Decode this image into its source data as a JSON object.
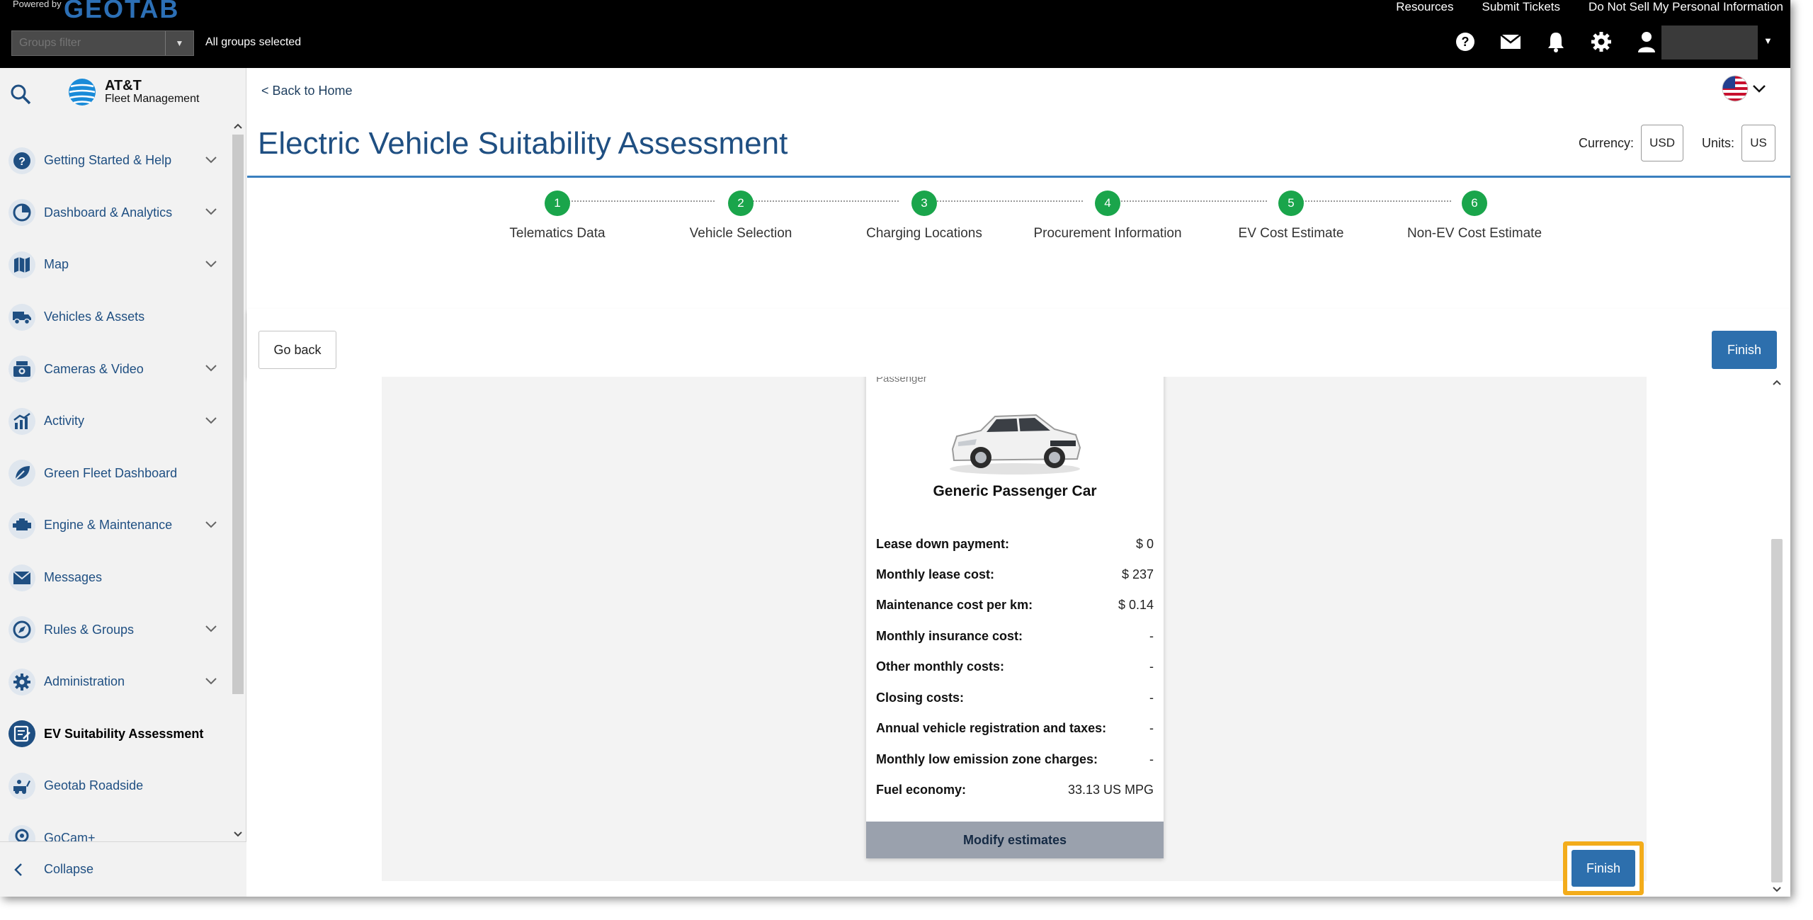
{
  "topbar": {
    "powered_by": "Powered by",
    "brand": "GEOTAB",
    "links": [
      "Resources",
      "Submit Tickets",
      "Do Not Sell My Personal Information"
    ],
    "groups_filter_placeholder": "Groups filter",
    "groups_selected": "All groups selected"
  },
  "sidebar": {
    "logo_line1": "AT&T",
    "logo_line2": "Fleet Management",
    "items": [
      {
        "label": "Getting Started & Help",
        "icon": "question-icon",
        "has_chevron": true
      },
      {
        "label": "Dashboard & Analytics",
        "icon": "pie-chart-icon",
        "has_chevron": true
      },
      {
        "label": "Map",
        "icon": "map-icon",
        "has_chevron": true
      },
      {
        "label": "Vehicles & Assets",
        "icon": "truck-icon",
        "has_chevron": false
      },
      {
        "label": "Cameras & Video",
        "icon": "camera-icon",
        "has_chevron": true
      },
      {
        "label": "Activity",
        "icon": "activity-chart-icon",
        "has_chevron": true
      },
      {
        "label": "Green Fleet Dashboard",
        "icon": "leaf-icon",
        "has_chevron": false
      },
      {
        "label": "Engine & Maintenance",
        "icon": "engine-icon",
        "has_chevron": true
      },
      {
        "label": "Messages",
        "icon": "envelope-icon",
        "has_chevron": false
      },
      {
        "label": "Rules & Groups",
        "icon": "compass-icon",
        "has_chevron": true
      },
      {
        "label": "Administration",
        "icon": "gear-icon",
        "has_chevron": true
      },
      {
        "label": "EV Suitability Assessment",
        "icon": "ev-assessment-icon",
        "has_chevron": false,
        "active": true
      },
      {
        "label": "Geotab Roadside",
        "icon": "roadside-icon",
        "has_chevron": false
      },
      {
        "label": "GoCam+",
        "icon": "gocam-icon",
        "has_chevron": false
      }
    ],
    "collapse": "Collapse"
  },
  "main": {
    "back_home": "< Back to Home",
    "title": "Electric Vehicle Suitability Assessment",
    "currency_label": "Currency:",
    "currency_value": "USD",
    "units_label": "Units:",
    "units_value": "US",
    "steps": [
      {
        "num": "1",
        "label": "Telematics Data"
      },
      {
        "num": "2",
        "label": "Vehicle Selection"
      },
      {
        "num": "3",
        "label": "Charging Locations"
      },
      {
        "num": "4",
        "label": "Procurement Information"
      },
      {
        "num": "5",
        "label": "EV Cost Estimate"
      },
      {
        "num": "6",
        "label": "Non-EV Cost Estimate"
      }
    ],
    "go_back": "Go back",
    "finish": "Finish"
  },
  "card": {
    "category": "Passenger",
    "name": "Generic Passenger Car",
    "specs": [
      {
        "label": "Lease down payment:",
        "value": "$ 0"
      },
      {
        "label": "Monthly lease cost:",
        "value": "$ 237"
      },
      {
        "label": "Maintenance cost per km:",
        "value": "$ 0.14"
      },
      {
        "label": "Monthly insurance cost:",
        "value": "-"
      },
      {
        "label": "Other monthly costs:",
        "value": "-"
      },
      {
        "label": "Closing costs:",
        "value": "-"
      },
      {
        "label": "Annual vehicle registration and taxes:",
        "value": "-"
      },
      {
        "label": "Monthly low emission zone charges:",
        "value": "-"
      },
      {
        "label": "Fuel economy:",
        "value": "33.13 US MPG"
      }
    ],
    "modify": "Modify estimates"
  },
  "colors": {
    "primary_blue": "#2d6fad",
    "nav_text": "#1f4f82",
    "step_green": "#1aa54b",
    "highlight": "#f3ac1b"
  }
}
